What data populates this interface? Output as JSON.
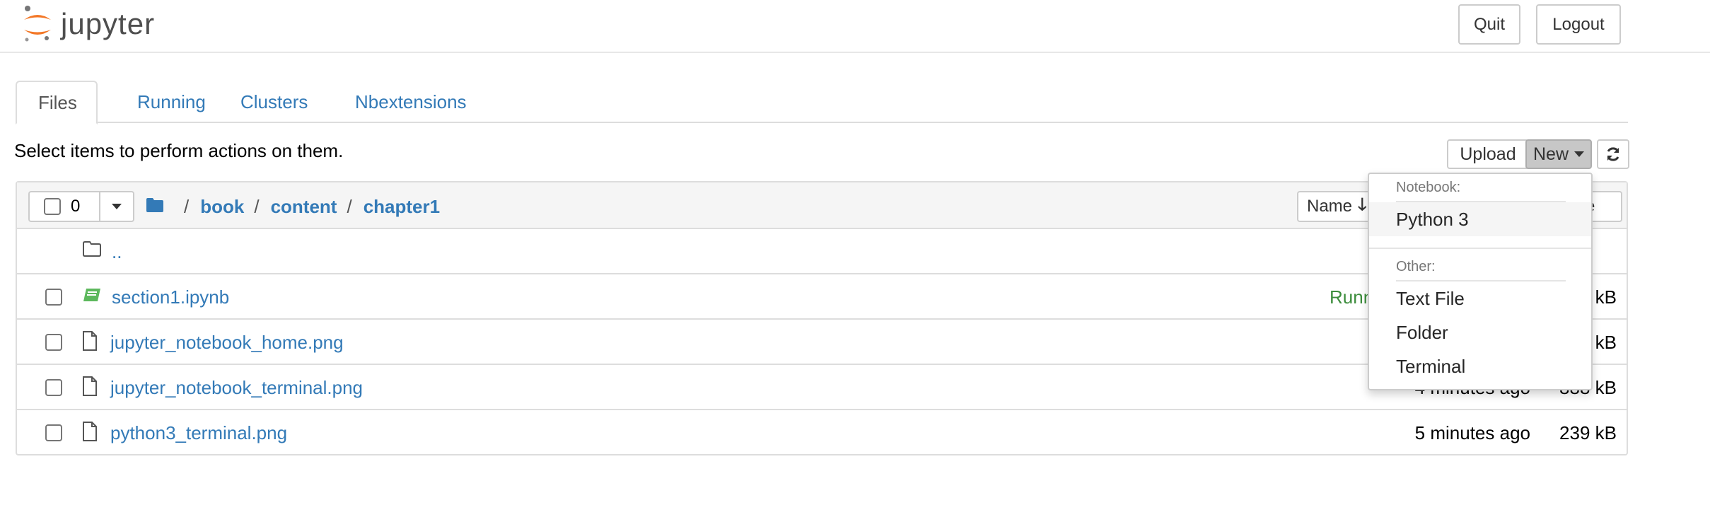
{
  "header": {
    "logo_text": "jupyter",
    "quit_label": "Quit",
    "logout_label": "Logout"
  },
  "tabs": [
    {
      "label": "Files",
      "active": true
    },
    {
      "label": "Running",
      "active": false
    },
    {
      "label": "Clusters",
      "active": false
    },
    {
      "label": "Nbextensions",
      "active": false
    }
  ],
  "toolbar": {
    "instructions": "Select items to perform actions on them.",
    "upload_label": "Upload",
    "new_label": "New",
    "refresh_icon": "refresh-icon"
  },
  "file_list": {
    "selected_count": "0",
    "breadcrumb": [
      "book",
      "content",
      "chapter1"
    ],
    "breadcrumb_sep": "/",
    "sort_label": "Name",
    "size_partial": "ze",
    "parent_dir": "..",
    "rows": [
      {
        "name": "section1.ipynb",
        "type": "notebook",
        "status": "Runn",
        "modified": "",
        "size": "kB"
      },
      {
        "name": "jupyter_notebook_home.png",
        "type": "file",
        "status": "",
        "modified": "",
        "size": "kB"
      },
      {
        "name": "jupyter_notebook_terminal.png",
        "type": "file",
        "status": "",
        "modified": "4 minutes ago",
        "size": "888 kB"
      },
      {
        "name": "python3_terminal.png",
        "type": "file",
        "status": "",
        "modified": "5 minutes ago",
        "size": "239 kB"
      }
    ]
  },
  "new_menu": {
    "notebook_header": "Notebook:",
    "notebook_items": [
      "Python 3"
    ],
    "other_header": "Other:",
    "other_items": [
      "Text File",
      "Folder",
      "Terminal"
    ]
  },
  "colors": {
    "link": "#337ab7",
    "logo_orange": "#f37726",
    "notebook_green": "#5cb85c"
  }
}
